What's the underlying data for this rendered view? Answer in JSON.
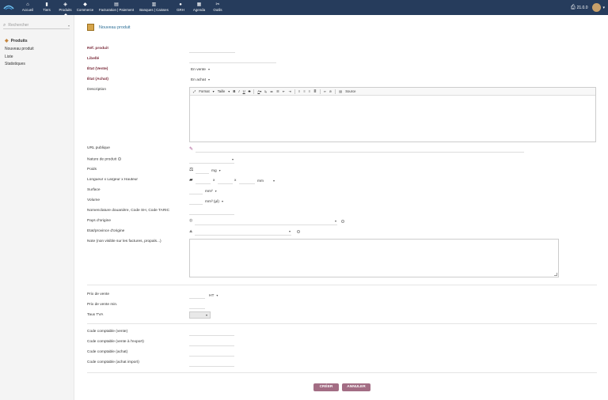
{
  "topnav": {
    "items": [
      {
        "label": "Accueil",
        "icon": "home-icon",
        "glyph": "⌂"
      },
      {
        "label": "Tiers",
        "icon": "building-icon",
        "glyph": "▮"
      },
      {
        "label": "Produits",
        "icon": "cube-icon",
        "glyph": "◈"
      },
      {
        "label": "Commerce",
        "icon": "briefcase-icon",
        "glyph": "◆"
      },
      {
        "label": "Facturation | Paiement",
        "icon": "invoice-icon",
        "glyph": "▤"
      },
      {
        "label": "Banques | Caisses",
        "icon": "bank-icon",
        "glyph": "▥"
      },
      {
        "label": "GRH",
        "icon": "user-icon",
        "glyph": "●"
      },
      {
        "label": "Agenda",
        "icon": "calendar-icon",
        "glyph": "▦"
      },
      {
        "label": "Outils",
        "icon": "tools-icon",
        "glyph": "✂"
      }
    ],
    "version": "21.0.0"
  },
  "sidebar": {
    "search_placeholder": "Rechercher",
    "section_title": "Produits",
    "links": [
      "Nouveau produit",
      "Liste",
      "Statistiques"
    ]
  },
  "page": {
    "title": "Nouveau produit"
  },
  "form": {
    "ref_label": "Réf. produit",
    "libelle_label": "Libellé",
    "etat_vente_label": "État (Vente)",
    "etat_vente_value": "En vente",
    "etat_achat_label": "État (Achat)",
    "etat_achat_value": "En achat",
    "description_label": "Description",
    "editor_toolbar": {
      "format": "Format",
      "taille": "Taille",
      "source": "Source"
    },
    "url_label": "URL publique",
    "nature_label": "Nature de produit",
    "poids_label": "Poids",
    "poids_unit": "mg",
    "dims_label": "Longueur x Largeur x Hauteur",
    "dims_unit": "mm",
    "dims_sep": "x",
    "surface_label": "Surface",
    "surface_unit": "mm²",
    "volume_label": "Volume",
    "volume_unit": "mm³ (µl)",
    "nomenclature_label": "Nomenclature douanière, Code SH, Code TARIC",
    "pays_label": "Pays d'origine",
    "etat_origine_label": "Etat/province d'origine",
    "note_label": "Note (non visible sur les factures, propals...)",
    "prix_vente_label": "Prix de vente",
    "prix_vente_base": "HT",
    "prix_min_label": "Prix de vente min.",
    "tva_label": "Taux TVA",
    "cc_vente_label": "Code comptable (vente)",
    "cc_export_label": "Code comptable (vente à l'export)",
    "cc_achat_label": "Code comptable (achat)",
    "cc_achat_import_label": "Code comptable (achat import)"
  },
  "buttons": {
    "create": "CRÉER",
    "cancel": "ANNULER"
  },
  "colors": {
    "topbar": "#263c5c",
    "required_label": "#7a2b3a",
    "button": "#a36d84",
    "title": "#2a6d96"
  }
}
